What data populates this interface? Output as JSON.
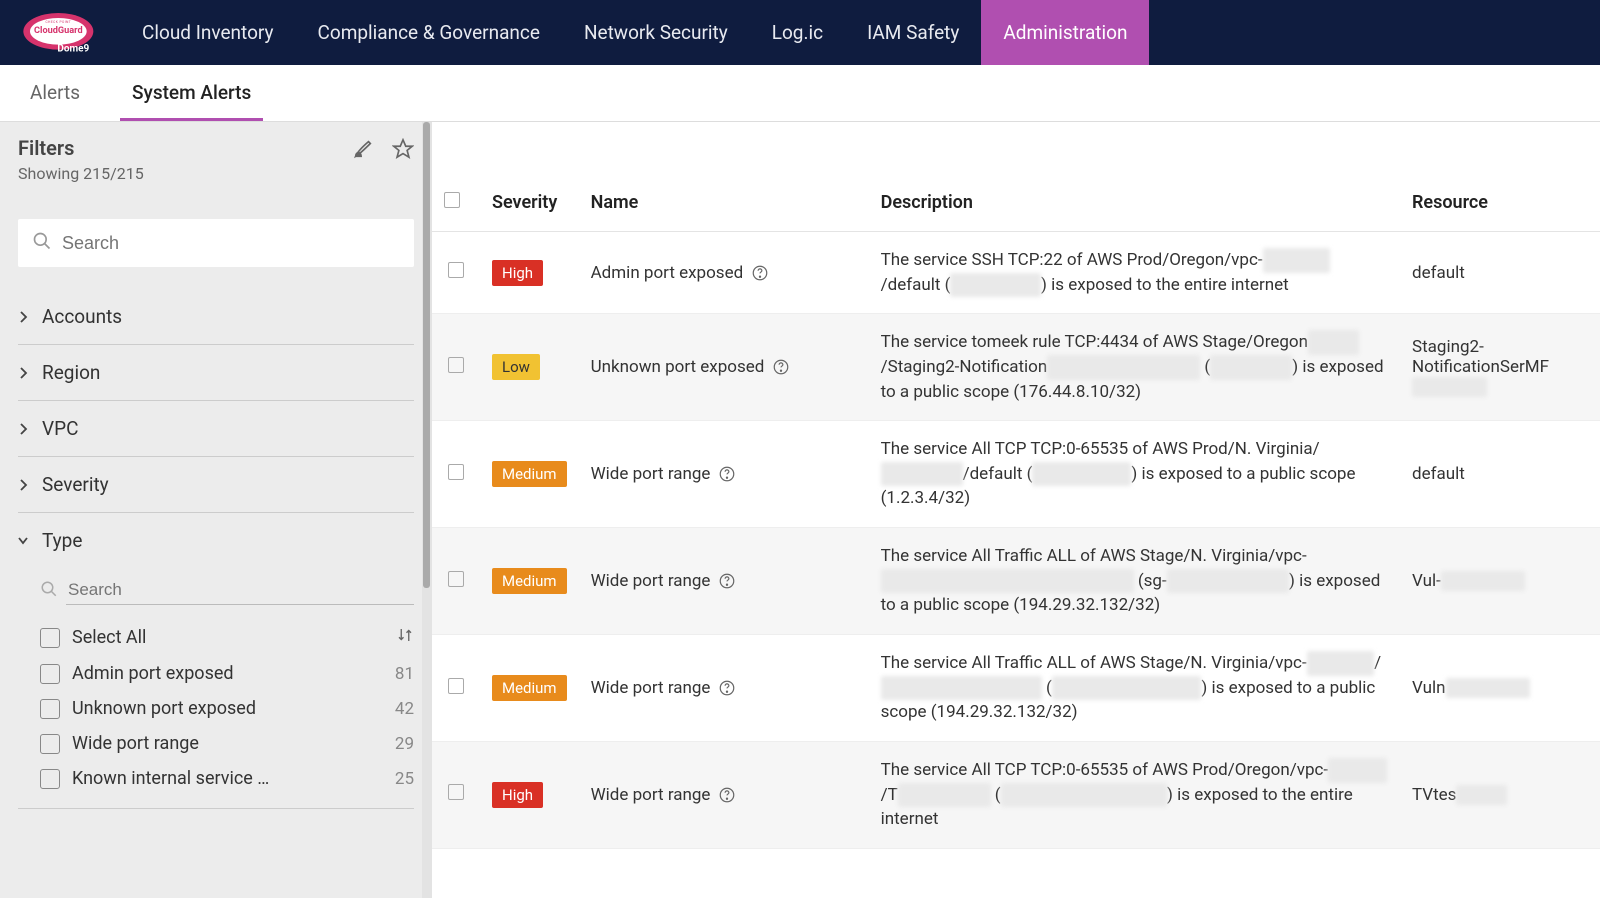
{
  "logo": {
    "line1": "CHECK POINT",
    "line2": "CloudGuard",
    "line3": "Dome9"
  },
  "nav": [
    {
      "label": "Cloud Inventory",
      "active": false
    },
    {
      "label": "Compliance & Governance",
      "active": false
    },
    {
      "label": "Network Security",
      "active": false
    },
    {
      "label": "Log.ic",
      "active": false
    },
    {
      "label": "IAM Safety",
      "active": false
    },
    {
      "label": "Administration",
      "active": true
    }
  ],
  "subtabs": [
    {
      "label": "Alerts",
      "active": false
    },
    {
      "label": "System Alerts",
      "active": true
    }
  ],
  "filters": {
    "title": "Filters",
    "showing": "Showing 215/215",
    "search_placeholder": "Search",
    "inner_search_placeholder": "Search",
    "sections": [
      {
        "label": "Accounts",
        "expanded": false
      },
      {
        "label": "Region",
        "expanded": false
      },
      {
        "label": "VPC",
        "expanded": false
      },
      {
        "label": "Severity",
        "expanded": false
      }
    ],
    "type_section": {
      "label": "Type",
      "select_all": "Select All",
      "items": [
        {
          "label": "Admin port exposed",
          "count": 81
        },
        {
          "label": "Unknown port exposed",
          "count": 42
        },
        {
          "label": "Wide port range",
          "count": 29
        },
        {
          "label": "Known internal service …",
          "count": 25
        }
      ]
    }
  },
  "table": {
    "headers": {
      "severity": "Severity",
      "name": "Name",
      "description": "Description",
      "resource": "Resource"
    },
    "rows": [
      {
        "severity": "High",
        "name": "Admin port exposed",
        "description_parts": [
          "The service SSH TCP:22 of AWS Prod/Oregon/vpc-",
          {
            "redact": "xxxxxxxx"
          },
          "/default (",
          {
            "redact": "sg-xxxxxxxx"
          },
          ") is exposed to the entire internet"
        ],
        "resource_parts": [
          "default"
        ],
        "alt": false
      },
      {
        "severity": "Low",
        "name": "Unknown port exposed",
        "description_parts": [
          "The service tomeek rule TCP:4434 of AWS Stage/Oregon",
          {
            "redact": "xxxxxx"
          },
          "/Staging2-Notification",
          {
            "redact": "Server-XXXX-XXXXX"
          },
          " (",
          {
            "redact": "sg-xxxxxxx"
          },
          ") is exposed to a public scope (176.44.8.10/32)"
        ],
        "resource_parts": [
          "Staging2-NotificationSer",
          "MF",
          {
            "redact": "XXXXXXX"
          }
        ],
        "alt": true
      },
      {
        "severity": "Medium",
        "name": "Wide port range",
        "description_parts": [
          "The service All TCP TCP:0-65535 of AWS Prod/N. Virginia/",
          {
            "redact": "vpc-xxxxxx"
          },
          "/default (",
          {
            "redact": "sg-xxxxxxxxx"
          },
          ") is exposed to a public scope (1.2.3.4/32)"
        ],
        "resource_parts": [
          "default"
        ],
        "alt": false
      },
      {
        "severity": "Medium",
        "name": "Wide port range",
        "description_parts": [
          "The service All Traffic ALL of AWS Stage/N. Virginia/vpc-",
          {
            "redact": "xxxxxxxxxxxxxxxxxxxxxxxxxxxxxx"
          },
          " (sg-",
          {
            "redact": "xxxxxxxxxxxxx x"
          },
          ") is exposed to a public scope (194.29.32.132/32)"
        ],
        "resource_parts": [
          "Vul-",
          {
            "redact": "xxxxxxxxxx"
          }
        ],
        "alt": true
      },
      {
        "severity": "Medium",
        "name": "Wide port range",
        "description_parts": [
          "The service All Traffic ALL of AWS Stage/N. Virginia/vpc-",
          {
            "redact": "xxxxxxxx"
          },
          "/",
          {
            "redact": "VulnerableWebServer"
          },
          " (",
          {
            "redact": "sg-xxxxxxxxxxxxxxx"
          },
          ") is exposed to a public scope (194.29.32.132/32)"
        ],
        "resource_parts": [
          "Vuln",
          {
            "redact": "xxxxxxxxxx"
          }
        ],
        "alt": false
      },
      {
        "severity": "High",
        "name": "Wide port range",
        "description_parts": [
          "The service All TCP TCP:0-65535 of AWS Prod/Oregon/vpc-",
          {
            "redact": "xxxxxxx"
          },
          "/T",
          {
            "redact": "xxxxxxxxxxx"
          },
          " (",
          {
            "redact": "sg-xxxxxxxxxxxxxxxxx"
          },
          ") is exposed to the entire internet"
        ],
        "resource_parts": [
          "TVtes",
          {
            "redact": "xxxxxx"
          }
        ],
        "alt": true
      }
    ]
  }
}
